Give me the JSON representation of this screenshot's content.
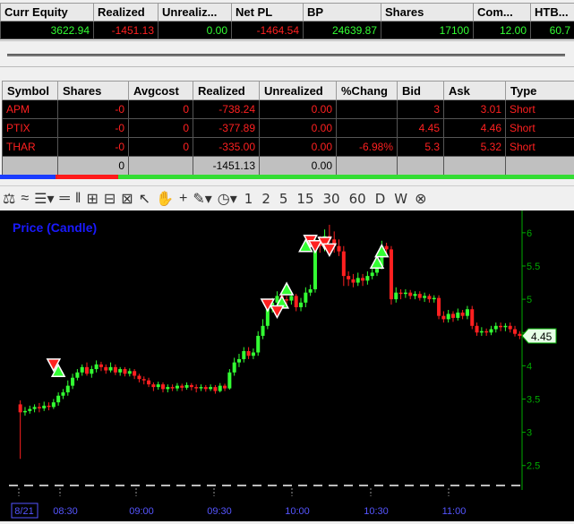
{
  "account": {
    "headers": [
      "Curr Equity",
      "Realized",
      "Unrealiz...",
      "Net PL",
      "BP",
      "Shares",
      "Com...",
      "HTB..."
    ],
    "values": [
      "3622.94",
      "-1451.13",
      "0.00",
      "-1464.54",
      "24639.87",
      "17100",
      "12.00",
      "60.7"
    ]
  },
  "positions": {
    "headers": [
      "Symbol",
      "Shares",
      "Avgcost",
      "Realized",
      "Unrealized",
      "%Chang",
      "Bid",
      "Ask",
      "Type"
    ],
    "rows": [
      {
        "symbol": "APM",
        "shares": "-0",
        "avgcost": "0",
        "realized": "-738.24",
        "unrealized": "0.00",
        "pct": "",
        "bid": "3",
        "ask": "3.01",
        "type": "Short"
      },
      {
        "symbol": "PTIX",
        "shares": "-0",
        "avgcost": "0",
        "realized": "-377.89",
        "unrealized": "0.00",
        "pct": "",
        "bid": "4.45",
        "ask": "4.46",
        "type": "Short"
      },
      {
        "symbol": "THAR",
        "shares": "-0",
        "avgcost": "0",
        "realized": "-335.00",
        "unrealized": "0.00",
        "pct": "-6.98%",
        "bid": "5.3",
        "ask": "5.32",
        "type": "Short"
      }
    ],
    "totals": {
      "shares": "0",
      "realized": "-1451.13",
      "unrealized": "0.00"
    }
  },
  "toolbar": {
    "intervals": [
      "1",
      "2",
      "5",
      "15",
      "30",
      "60",
      "D",
      "W"
    ]
  },
  "chart_data": {
    "type": "candlestick",
    "title": "Price (Candle)",
    "ylim": [
      2.2,
      6.2
    ],
    "y_ticks": [
      "6",
      "5.5",
      "5",
      "4.5",
      "4",
      "3.5",
      "3",
      "2.5"
    ],
    "x_ticks": [
      "8/21",
      "08:30",
      "09:00",
      "09:30",
      "10:00",
      "10:30",
      "11:00"
    ],
    "last_price": "4.45",
    "colors": {
      "up": "#33ff33",
      "down": "#ff2020",
      "axis": "#00aa00",
      "title": "#1a1aff"
    },
    "candles": [
      [
        0,
        3.42,
        3.3,
        3.48,
        2.6
      ],
      [
        1,
        3.3,
        3.32,
        3.38,
        3.25
      ],
      [
        2,
        3.32,
        3.35,
        3.4,
        3.28
      ],
      [
        3,
        3.35,
        3.38,
        3.42,
        3.3
      ],
      [
        4,
        3.38,
        3.36,
        3.44,
        3.3
      ],
      [
        5,
        3.36,
        3.4,
        3.46,
        3.32
      ],
      [
        6,
        3.4,
        3.38,
        3.45,
        3.33
      ],
      [
        7,
        3.38,
        3.45,
        3.5,
        3.35
      ],
      [
        8,
        3.45,
        3.55,
        3.6,
        3.4
      ],
      [
        9,
        3.55,
        3.6,
        3.65,
        3.5
      ],
      [
        10,
        3.6,
        3.7,
        3.78,
        3.55
      ],
      [
        11,
        3.7,
        3.82,
        3.88,
        3.65
      ],
      [
        12,
        3.82,
        3.9,
        3.95,
        3.78
      ],
      [
        13,
        3.9,
        3.98,
        4.02,
        3.85
      ],
      [
        14,
        3.98,
        3.88,
        4.05,
        3.85
      ],
      [
        15,
        3.88,
        3.95,
        4.0,
        3.82
      ],
      [
        16,
        3.95,
        4.02,
        4.08,
        3.9
      ],
      [
        17,
        4.02,
        3.98,
        4.06,
        3.92
      ],
      [
        18,
        3.98,
        3.93,
        4.02,
        3.88
      ],
      [
        19,
        3.93,
        3.98,
        4.05,
        3.9
      ],
      [
        20,
        3.98,
        3.9,
        4.02,
        3.86
      ],
      [
        21,
        3.9,
        3.95,
        3.98,
        3.85
      ],
      [
        22,
        3.95,
        3.88,
        3.98,
        3.84
      ],
      [
        23,
        3.88,
        3.92,
        3.96,
        3.84
      ],
      [
        24,
        3.92,
        3.85,
        3.95,
        3.8
      ],
      [
        25,
        3.85,
        3.8,
        3.88,
        3.75
      ],
      [
        26,
        3.8,
        3.78,
        3.84,
        3.72
      ],
      [
        27,
        3.78,
        3.72,
        3.82,
        3.68
      ],
      [
        28,
        3.72,
        3.68,
        3.75,
        3.62
      ],
      [
        29,
        3.68,
        3.72,
        3.76,
        3.64
      ],
      [
        30,
        3.72,
        3.65,
        3.75,
        3.6
      ],
      [
        31,
        3.65,
        3.68,
        3.72,
        3.6
      ],
      [
        32,
        3.68,
        3.66,
        3.72,
        3.62
      ],
      [
        33,
        3.66,
        3.7,
        3.74,
        3.62
      ],
      [
        34,
        3.7,
        3.67,
        3.73,
        3.62
      ],
      [
        35,
        3.67,
        3.71,
        3.75,
        3.64
      ],
      [
        36,
        3.71,
        3.68,
        3.74,
        3.63
      ],
      [
        37,
        3.68,
        3.66,
        3.72,
        3.6
      ],
      [
        38,
        3.66,
        3.68,
        3.72,
        3.62
      ],
      [
        39,
        3.68,
        3.65,
        3.71,
        3.61
      ],
      [
        40,
        3.65,
        3.68,
        3.72,
        3.62
      ],
      [
        41,
        3.68,
        3.62,
        3.71,
        3.58
      ],
      [
        42,
        3.62,
        3.7,
        3.74,
        3.6
      ],
      [
        43,
        3.7,
        3.66,
        3.73,
        3.62
      ],
      [
        44,
        3.66,
        3.9,
        3.95,
        3.64
      ],
      [
        45,
        3.9,
        4.05,
        4.12,
        3.85
      ],
      [
        46,
        4.05,
        4.1,
        4.18,
        3.98
      ],
      [
        47,
        4.1,
        4.22,
        4.28,
        4.05
      ],
      [
        48,
        4.22,
        4.15,
        4.28,
        4.1
      ],
      [
        49,
        4.15,
        4.2,
        4.26,
        4.1
      ],
      [
        50,
        4.2,
        4.45,
        4.52,
        4.15
      ],
      [
        51,
        4.45,
        4.6,
        4.7,
        4.4
      ],
      [
        52,
        4.6,
        4.85,
        4.95,
        4.55
      ],
      [
        53,
        4.85,
        4.95,
        5.02,
        4.8
      ],
      [
        54,
        4.95,
        5.05,
        5.12,
        4.9
      ],
      [
        55,
        5.05,
        5.0,
        5.1,
        4.92
      ],
      [
        56,
        5.0,
        4.98,
        5.05,
        4.9
      ],
      [
        57,
        4.98,
        5.05,
        5.1,
        4.92
      ],
      [
        58,
        5.05,
        4.88,
        5.08,
        4.82
      ],
      [
        59,
        4.88,
        4.95,
        5.02,
        4.82
      ],
      [
        60,
        4.95,
        5.1,
        5.18,
        4.88
      ],
      [
        61,
        5.1,
        5.15,
        5.22,
        5.05
      ],
      [
        62,
        5.15,
        5.85,
        5.92,
        5.1
      ],
      [
        63,
        5.85,
        5.8,
        5.95,
        5.7
      ],
      [
        64,
        5.8,
        5.95,
        6.05,
        5.72
      ],
      [
        65,
        5.95,
        5.9,
        6.12,
        5.85
      ],
      [
        66,
        5.9,
        5.8,
        6.02,
        5.7
      ],
      [
        67,
        5.8,
        5.72,
        5.9,
        5.65
      ],
      [
        68,
        5.72,
        5.35,
        5.8,
        5.2
      ],
      [
        69,
        5.35,
        5.3,
        5.42,
        5.2
      ],
      [
        70,
        5.3,
        5.25,
        5.38,
        5.18
      ],
      [
        71,
        5.25,
        5.32,
        5.4,
        5.2
      ],
      [
        72,
        5.32,
        5.28,
        5.38,
        5.2
      ],
      [
        73,
        5.28,
        5.35,
        5.42,
        5.22
      ],
      [
        74,
        5.35,
        5.4,
        5.48,
        5.3
      ],
      [
        75,
        5.4,
        5.5,
        5.58,
        5.35
      ],
      [
        76,
        5.5,
        5.8,
        5.88,
        5.45
      ],
      [
        77,
        5.8,
        5.75,
        5.85,
        5.65
      ],
      [
        78,
        5.75,
        5.0,
        5.8,
        4.92
      ],
      [
        79,
        5.0,
        5.1,
        5.18,
        4.95
      ],
      [
        80,
        5.1,
        5.08,
        5.15,
        5.0
      ],
      [
        81,
        5.08,
        5.1,
        5.15,
        5.02
      ],
      [
        82,
        5.1,
        5.05,
        5.14,
        5.0
      ],
      [
        83,
        5.05,
        5.08,
        5.12,
        5.0
      ],
      [
        84,
        5.08,
        5.02,
        5.12,
        4.98
      ],
      [
        85,
        5.02,
        5.05,
        5.1,
        4.96
      ],
      [
        86,
        5.05,
        5.0,
        5.08,
        4.95
      ],
      [
        87,
        5.0,
        5.02,
        5.06,
        4.95
      ],
      [
        88,
        5.02,
        4.75,
        5.06,
        4.7
      ],
      [
        89,
        4.75,
        4.7,
        4.82,
        4.65
      ],
      [
        90,
        4.7,
        4.78,
        4.84,
        4.65
      ],
      [
        91,
        4.78,
        4.72,
        4.82,
        4.66
      ],
      [
        92,
        4.72,
        4.8,
        4.86,
        4.68
      ],
      [
        93,
        4.8,
        4.75,
        4.84,
        4.7
      ],
      [
        94,
        4.75,
        4.85,
        4.9,
        4.7
      ],
      [
        95,
        4.85,
        4.6,
        4.9,
        4.55
      ],
      [
        96,
        4.6,
        4.5,
        4.65,
        4.45
      ],
      [
        97,
        4.5,
        4.52,
        4.58,
        4.45
      ],
      [
        98,
        4.52,
        4.5,
        4.56,
        4.45
      ],
      [
        99,
        4.5,
        4.55,
        4.6,
        4.46
      ],
      [
        100,
        4.55,
        4.6,
        4.65,
        4.5
      ],
      [
        101,
        4.6,
        4.58,
        4.65,
        4.52
      ],
      [
        102,
        4.58,
        4.6,
        4.64,
        4.52
      ],
      [
        103,
        4.6,
        4.55,
        4.65,
        4.5
      ],
      [
        104,
        4.55,
        4.48,
        4.6,
        4.44
      ],
      [
        105,
        4.48,
        4.45,
        4.52,
        4.4
      ]
    ],
    "buy_markers": [
      [
        8,
        3.92
      ],
      [
        55,
        4.95
      ],
      [
        56,
        5.15
      ],
      [
        60,
        5.8
      ],
      [
        75,
        5.55
      ],
      [
        76,
        5.72
      ]
    ],
    "sell_markers": [
      [
        7,
        4.02
      ],
      [
        52,
        4.92
      ],
      [
        54,
        4.82
      ],
      [
        61,
        5.88
      ],
      [
        62,
        5.8
      ],
      [
        64,
        5.85
      ],
      [
        65,
        5.75
      ]
    ]
  }
}
